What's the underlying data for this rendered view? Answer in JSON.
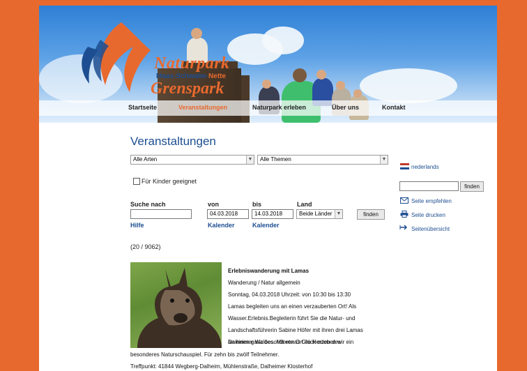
{
  "logo": {
    "line1": "Naturpark",
    "line2a": "Maas-Schwalm-",
    "line2b": "Nette",
    "line3": "Grenspark"
  },
  "nav": [
    {
      "label": "Startseite",
      "active": false
    },
    {
      "label": "Veranstaltungen",
      "active": true
    },
    {
      "label": "Naturpark erleben",
      "active": false
    },
    {
      "label": "Über uns",
      "active": false
    },
    {
      "label": "Kontakt",
      "active": false
    }
  ],
  "page_title": "Veranstaltungen",
  "filters": {
    "arten": "Alle Arten",
    "themen": "Alle Themen",
    "kinder_label": "Für Kinder geeignet",
    "kinder_checked": false
  },
  "search": {
    "suche_label": "Suche nach",
    "suche_value": "",
    "von_label": "von",
    "von_value": "04.03.2018",
    "bis_label": "bis",
    "bis_value": "14.03.2018",
    "land_label": "Land",
    "land_value": "Beide Länder",
    "submit": "finden",
    "hilfe": "Hilfe",
    "kalender1": "Kalender",
    "kalender2": "Kalender"
  },
  "sidebar": {
    "language": "nederlands",
    "search_submit": "finden",
    "search_value": "",
    "recommend": "Seite empfehlen",
    "print": "Seite drucken",
    "overview": "Seitenübersicht"
  },
  "result_count": "(20 / 9062)",
  "event": {
    "title": "Erlebniswanderung mit Lamas",
    "category": "Wanderung / Natur allgemein",
    "date": "Sonntag, 04.03.2018 Uhrzeit: von 10:30 bis 13:30",
    "desc": [
      "Lamas begleiten uns an einen verzauberten Ort! Als",
      "Wasser.Erlebnis.Begleiterin führt Sie die Natur- und",
      "Landschaftsführerin Sabine Höfer mit ihren drei Lamas",
      "an einen ganz besonderen Ort im Herzen des",
      "Dalheimer Waldes. Mit etwas Glück erleben wir ein"
    ],
    "desc_full": "besonderes Naturschauspiel. Für zehn bis zwölf Teilnehmer.",
    "meeting": "Treffpunkt: 41844 Wegberg-Dalheim, Mühlenstraße, Dalheimer Klosterhof"
  },
  "colors": {
    "accent": "#e8692e",
    "link": "#1d4e91"
  }
}
